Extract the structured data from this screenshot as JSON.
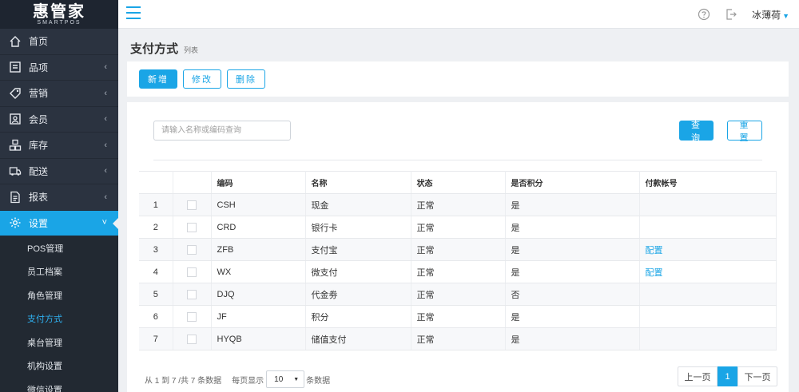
{
  "brand": {
    "name": "惠管家",
    "tagline": "SMARTPOS"
  },
  "sidebar": {
    "items": [
      {
        "label": "首页",
        "icon": "home-icon",
        "has_children": false
      },
      {
        "label": "品项",
        "icon": "list-icon",
        "has_children": true
      },
      {
        "label": "营销",
        "icon": "tag-icon",
        "has_children": true
      },
      {
        "label": "会员",
        "icon": "member-card-icon",
        "has_children": true
      },
      {
        "label": "库存",
        "icon": "inventory-icon",
        "has_children": true
      },
      {
        "label": "配送",
        "icon": "truck-icon",
        "has_children": true
      },
      {
        "label": "报表",
        "icon": "report-icon",
        "has_children": true
      },
      {
        "label": "设置",
        "icon": "gear-icon",
        "has_children": true,
        "expanded": true
      }
    ],
    "settings_sub": [
      {
        "label": "POS管理"
      },
      {
        "label": "员工档案"
      },
      {
        "label": "角色管理"
      },
      {
        "label": "支付方式",
        "active": true
      },
      {
        "label": "桌台管理"
      },
      {
        "label": "机构设置"
      },
      {
        "label": "微信设置"
      }
    ]
  },
  "header": {
    "user_name": "冰薄荷"
  },
  "page": {
    "title": "支付方式",
    "subtitle": "列表"
  },
  "toolbar": {
    "add_label": "新增",
    "edit_label": "修改",
    "delete_label": "删除"
  },
  "search": {
    "placeholder": "请输入名称或编码查询",
    "query_label": "查询",
    "reset_label": "重置"
  },
  "table": {
    "columns": [
      "编码",
      "名称",
      "状态",
      "是否积分",
      "付款帐号"
    ],
    "rows": [
      {
        "no": "1",
        "code": "CSH",
        "name": "现金",
        "status": "正常",
        "points": "是",
        "account": ""
      },
      {
        "no": "2",
        "code": "CRD",
        "name": "银行卡",
        "status": "正常",
        "points": "是",
        "account": ""
      },
      {
        "no": "3",
        "code": "ZFB",
        "name": "支付宝",
        "status": "正常",
        "points": "是",
        "account": "配置"
      },
      {
        "no": "4",
        "code": "WX",
        "name": "微支付",
        "status": "正常",
        "points": "是",
        "account": "配置"
      },
      {
        "no": "5",
        "code": "DJQ",
        "name": "代金劵",
        "status": "正常",
        "points": "否",
        "account": ""
      },
      {
        "no": "6",
        "code": "JF",
        "name": "积分",
        "status": "正常",
        "points": "是",
        "account": ""
      },
      {
        "no": "7",
        "code": "HYQB",
        "name": "储值支付",
        "status": "正常",
        "points": "是",
        "account": ""
      }
    ]
  },
  "pagination": {
    "summary": "从 1 到 7 /共 7 条数据",
    "per_page_label": "每页显示",
    "per_page_value": "10",
    "per_page_suffix": "条数据",
    "prev_label": "上一页",
    "current_page": "1",
    "next_label": "下一页"
  },
  "colors": {
    "accent": "#1aa5e6",
    "sidebar_bg": "#2b3340"
  }
}
